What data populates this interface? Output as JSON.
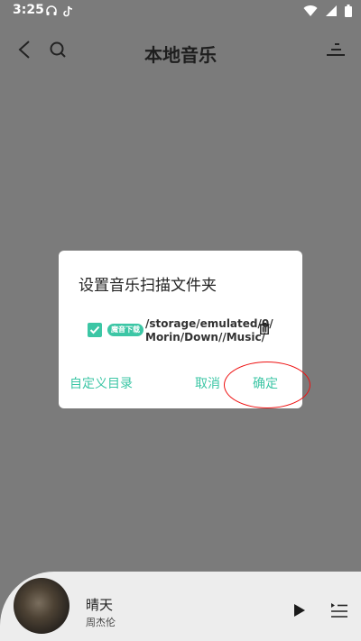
{
  "status_bar": {
    "time": "3:25",
    "left_icons": [
      "headphones-icon",
      "tiktok-icon"
    ],
    "right_icons": [
      "wifi-icon",
      "signal-icon",
      "battery-icon"
    ]
  },
  "header": {
    "title": "本地音乐",
    "icons": [
      "back-icon",
      "search-icon",
      "sort-icon"
    ]
  },
  "dialog": {
    "title": "设置音乐扫描文件夹",
    "folder": {
      "checked": true,
      "tag": "魔音下载",
      "path_line1": "/storage/emulated/0/",
      "path_line2": "Morin/Down//Music/"
    },
    "custom_dir_label": "自定义目录",
    "cancel_label": "取消",
    "confirm_label": "确定"
  },
  "player": {
    "song": "晴天",
    "artist": "周杰伦"
  },
  "colors": {
    "accent": "#3cc6a5",
    "overlay": "#7b7b7b",
    "annotation": "#e11111"
  }
}
